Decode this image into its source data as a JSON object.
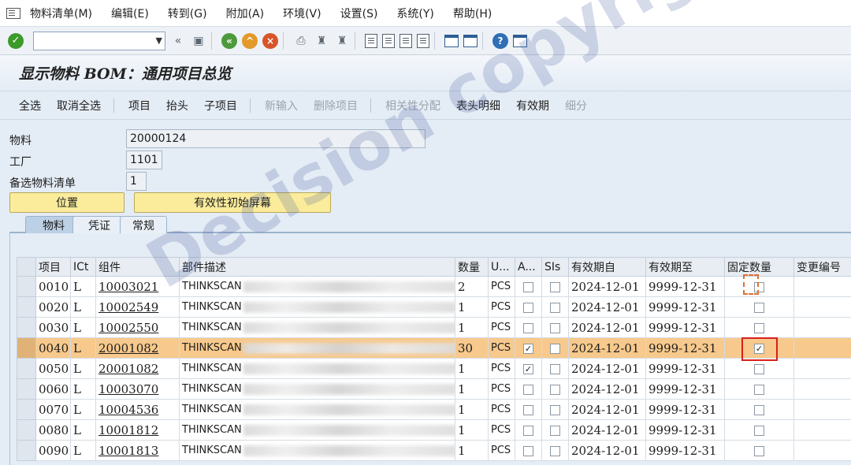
{
  "menu": {
    "items": [
      "物料清单(M)",
      "编辑(E)",
      "转到(G)",
      "附加(A)",
      "环境(V)",
      "设置(S)",
      "系统(Y)",
      "帮助(H)"
    ]
  },
  "toolbar": {
    "command_value": "",
    "back_glyph": "«"
  },
  "title": "显示物料 BOM：通用项目总览",
  "app_toolbar": {
    "select_all": "全选",
    "deselect_all": "取消全选",
    "item": "项目",
    "header": "抬头",
    "sub_item": "子项目",
    "new_entry": "新输入",
    "delete_item": "删除项目",
    "dependency": "相关性分配",
    "header_detail": "表头明细",
    "validity": "有效期",
    "detail": "细分"
  },
  "header_fields": {
    "material_label": "物料",
    "material_value": "20000124",
    "plant_label": "工厂",
    "plant_value": "1101",
    "alt_bom_label": "备选物料清单",
    "alt_bom_value": "1",
    "position_button": "位置",
    "validity_button": "有效性初始屏幕"
  },
  "tabs": [
    "物料",
    "凭证",
    "常规"
  ],
  "table": {
    "columns": [
      "项目",
      "ICt",
      "组件",
      "部件描述",
      "数量",
      "U...",
      "A...",
      "SIs",
      "有效期自",
      "有效期至",
      "固定数量",
      "变更编号"
    ],
    "rows": [
      {
        "item": "0010",
        "ict": "L",
        "component": "10003021",
        "desc": "THINKSCAN",
        "qty": "2",
        "unit": "PCS",
        "a": false,
        "sis": false,
        "valid_from": "2024-12-01",
        "valid_to": "9999-12-31",
        "fixed": false,
        "change": ""
      },
      {
        "item": "0020",
        "ict": "L",
        "component": "10002549",
        "desc": "THINKSCAN",
        "qty": "1",
        "unit": "PCS",
        "a": false,
        "sis": false,
        "valid_from": "2024-12-01",
        "valid_to": "9999-12-31",
        "fixed": false,
        "change": ""
      },
      {
        "item": "0030",
        "ict": "L",
        "component": "10002550",
        "desc": "THINKSCAN",
        "qty": "1",
        "unit": "PCS",
        "a": false,
        "sis": false,
        "valid_from": "2024-12-01",
        "valid_to": "9999-12-31",
        "fixed": false,
        "change": ""
      },
      {
        "item": "0040",
        "ict": "L",
        "component": "20001082",
        "desc": "THINKSCAN",
        "qty": "30",
        "unit": "PCS",
        "a": true,
        "sis": false,
        "valid_from": "2024-12-01",
        "valid_to": "9999-12-31",
        "fixed": true,
        "change": ""
      },
      {
        "item": "0050",
        "ict": "L",
        "component": "20001082",
        "desc": "THINKSCAN",
        "qty": "1",
        "unit": "PCS",
        "a": true,
        "sis": false,
        "valid_from": "2024-12-01",
        "valid_to": "9999-12-31",
        "fixed": false,
        "change": ""
      },
      {
        "item": "0060",
        "ict": "L",
        "component": "10003070",
        "desc": "THINKSCAN",
        "qty": "1",
        "unit": "PCS",
        "a": false,
        "sis": false,
        "valid_from": "2024-12-01",
        "valid_to": "9999-12-31",
        "fixed": false,
        "change": ""
      },
      {
        "item": "0070",
        "ict": "L",
        "component": "10004536",
        "desc": "THINKSCAN",
        "qty": "1",
        "unit": "PCS",
        "a": false,
        "sis": false,
        "valid_from": "2024-12-01",
        "valid_to": "9999-12-31",
        "fixed": false,
        "change": ""
      },
      {
        "item": "0080",
        "ict": "L",
        "component": "10001812",
        "desc": "THINKSCAN",
        "qty": "1",
        "unit": "PCS",
        "a": false,
        "sis": false,
        "valid_from": "2024-12-01",
        "valid_to": "9999-12-31",
        "fixed": false,
        "change": ""
      },
      {
        "item": "0090",
        "ict": "L",
        "component": "10001813",
        "desc": "THINKSCAN",
        "qty": "1",
        "unit": "PCS",
        "a": false,
        "sis": false,
        "valid_from": "2024-12-01",
        "valid_to": "9999-12-31",
        "fixed": false,
        "change": ""
      }
    ],
    "highlight_row": 3,
    "check_glyph": "✓"
  },
  "watermark": "Decision copyright",
  "colors": {
    "highlight_row": "#f7c98c",
    "annotation_red": "#d8201b",
    "yellow_button": "#fbec9c",
    "ok_green": "#3c9a2b"
  }
}
